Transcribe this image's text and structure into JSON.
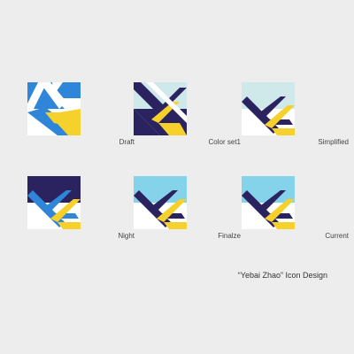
{
  "colors": {
    "background": "#ededed",
    "white": "#ffffff",
    "blue": "#2f86d8",
    "light_blue": "#85d3ea",
    "pale_cyan": "#cfe8e9",
    "navy": "#2a2360",
    "yellow": "#f7d12b",
    "label": "#444444"
  },
  "variants": [
    {
      "label": "Draft"
    },
    {
      "label": "Color set1"
    },
    {
      "label": "Simplified"
    },
    {
      "label": "Night"
    },
    {
      "label": "Finalze"
    },
    {
      "label": "Current"
    }
  ],
  "footer": {
    "title": "“Yebai Zhao” Icon Design"
  }
}
